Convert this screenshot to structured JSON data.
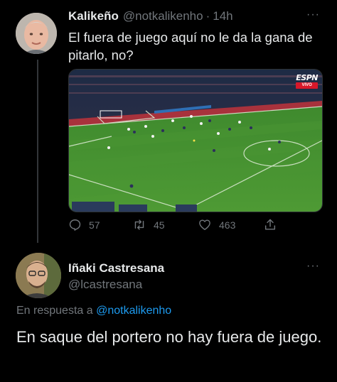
{
  "tweet": {
    "author_name": "Kalikeño",
    "author_handle": "@notkalikenho",
    "separator": "·",
    "time": "14h",
    "text": "El fuera de juego aquí no le da la gana de pitarlo, no?",
    "media": {
      "broadcaster": "ESPN",
      "live_label": "VIVO"
    },
    "stats": {
      "replies": "57",
      "retweets": "45",
      "likes": "463"
    },
    "more_label": "···"
  },
  "reply": {
    "author_name": "Iñaki Castresana",
    "author_handle": "@lcastresana",
    "more_label": "···",
    "reply_prefix": "En respuesta a",
    "reply_mention": "@notkalikenho",
    "text": "En saque del portero no hay fuera de juego."
  },
  "colors": {
    "background": "#000000",
    "text": "#e7e9ea",
    "secondary": "#71767b",
    "link": "#1d9bf0"
  },
  "icons": {
    "reply": "reply-icon",
    "retweet": "retweet-icon",
    "like": "heart-icon",
    "share": "share-icon",
    "more": "more-icon"
  }
}
